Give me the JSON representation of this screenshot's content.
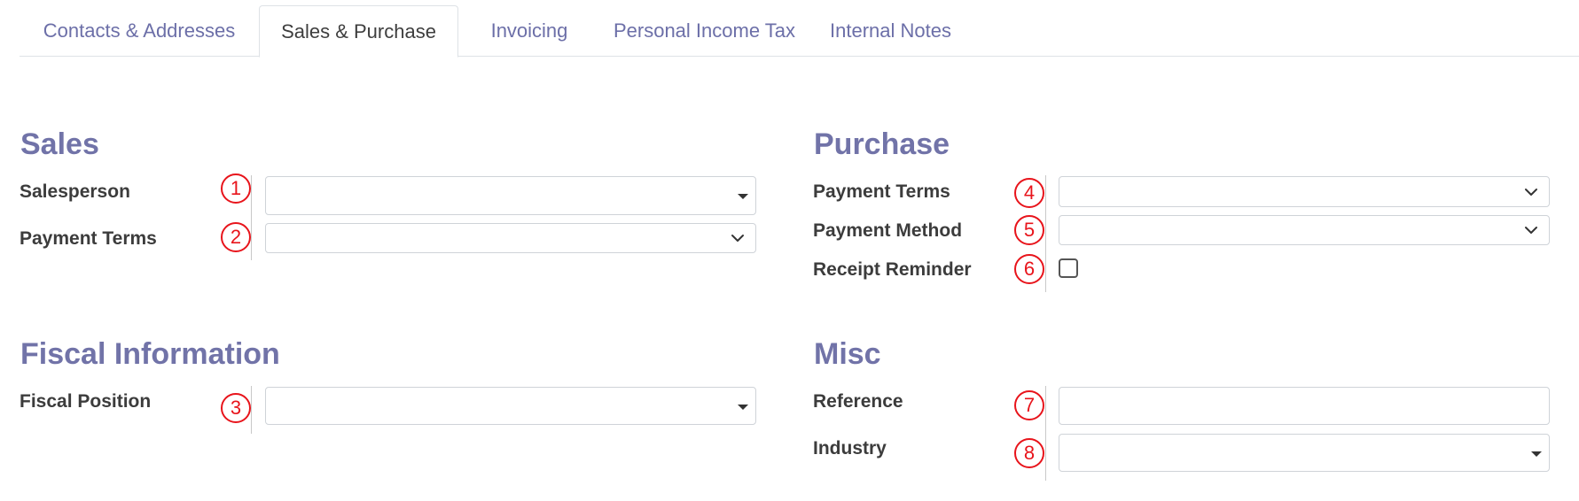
{
  "tabs": [
    {
      "label": "Contacts & Addresses",
      "active": false
    },
    {
      "label": "Sales & Purchase",
      "active": true
    },
    {
      "label": "Invoicing",
      "active": false
    },
    {
      "label": "Personal Income Tax",
      "active": false
    },
    {
      "label": "Internal Notes",
      "active": false
    }
  ],
  "sales": {
    "title": "Sales",
    "salesperson_label": "Salesperson",
    "payment_terms_label": "Payment Terms"
  },
  "fiscal": {
    "title": "Fiscal Information",
    "fiscal_position_label": "Fiscal Position"
  },
  "purchase": {
    "title": "Purchase",
    "payment_terms_label": "Payment Terms",
    "payment_method_label": "Payment Method",
    "receipt_reminder_label": "Receipt Reminder"
  },
  "misc": {
    "title": "Misc",
    "reference_label": "Reference",
    "industry_label": "Industry"
  },
  "markers": [
    "1",
    "2",
    "3",
    "4",
    "5",
    "6",
    "7",
    "8"
  ],
  "colors": {
    "accent": "#7173a8",
    "tab_inactive": "#6c6fa8",
    "marker": "#e8141b",
    "border": "#cfd3d8"
  },
  "icons": {
    "dropdown_caret": "caret-down-icon",
    "select_chevron": "chevron-down-icon"
  }
}
